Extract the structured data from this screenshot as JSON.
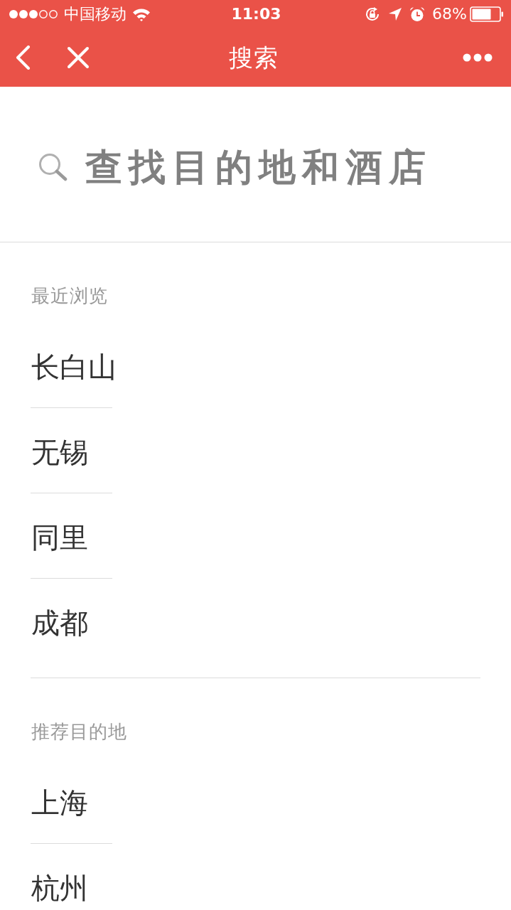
{
  "status_bar": {
    "carrier": "中国移动",
    "time": "11:03",
    "battery": "68%"
  },
  "nav_bar": {
    "title": "搜索"
  },
  "search": {
    "placeholder": "查找目的地和酒店"
  },
  "sections": [
    {
      "title": "最近浏览",
      "items": [
        "长白山",
        "无锡",
        "同里",
        "成都"
      ]
    },
    {
      "title": "推荐目的地",
      "items": [
        "上海",
        "杭州"
      ]
    }
  ]
}
